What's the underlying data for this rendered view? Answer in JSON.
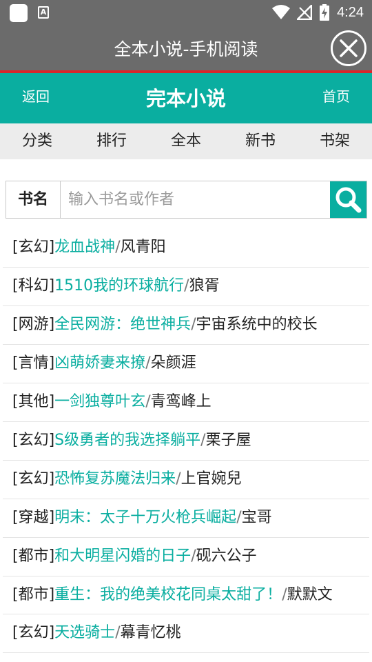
{
  "status_bar": {
    "time": "4:24"
  },
  "window": {
    "title": "全本小说-手机阅读"
  },
  "header": {
    "back_label": "返回",
    "brand": "完本小说",
    "home_label": "首页"
  },
  "nav": [
    "分类",
    "排行",
    "全本",
    "新书",
    "书架"
  ],
  "search": {
    "label": "书名",
    "placeholder": "输入书名或作者"
  },
  "books": [
    {
      "category": "[玄幻]",
      "title": "龙血战神",
      "author": "风青阳"
    },
    {
      "category": "[科幻]",
      "title": "1510我的环球航行",
      "author": "狼胥"
    },
    {
      "category": "[网游]",
      "title": "全民网游：绝世神兵",
      "author": "宇宙系统中的校长"
    },
    {
      "category": "[言情]",
      "title": "凶萌娇妻来撩",
      "author": "朵颜涯"
    },
    {
      "category": "[其他]",
      "title": "一剑独尊叶玄",
      "author": "青鸾峰上"
    },
    {
      "category": "[玄幻]",
      "title": "S级勇者的我选择躺平",
      "author": "栗子屋"
    },
    {
      "category": "[玄幻]",
      "title": "恐怖复苏魔法归来",
      "author": "上官婉兒"
    },
    {
      "category": "[穿越]",
      "title": "明末：太子十万火枪兵崛起",
      "author": "宝哥"
    },
    {
      "category": "[都市]",
      "title": "和大明星闪婚的日子",
      "author": "砚六公子"
    },
    {
      "category": "[都市]",
      "title": "重生：我的绝美校花同桌太甜了！",
      "author": "默默文"
    },
    {
      "category": "[玄幻]",
      "title": "天选骑士",
      "author": "幕青忆桃"
    }
  ],
  "colors": {
    "accent": "#0aaea0",
    "titlebar": "#6b6b6b",
    "divider_red": "#d9262b"
  }
}
